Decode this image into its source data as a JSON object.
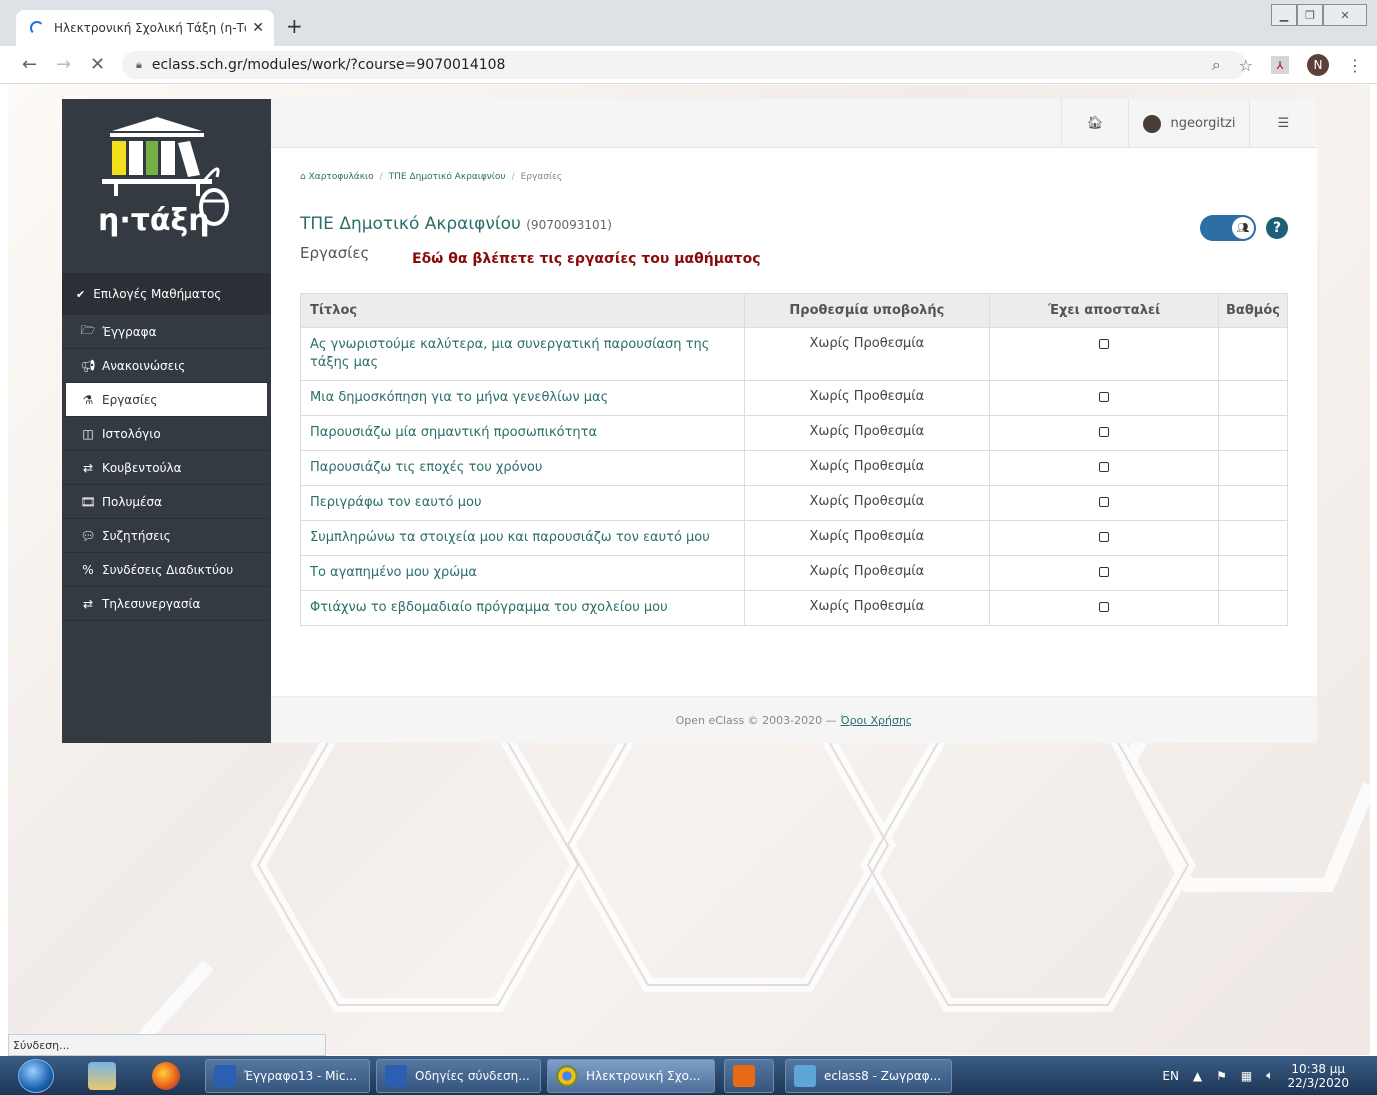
{
  "browser": {
    "tab_title": "Ηλεκτρονική Σχολική Τάξη (η-Τά",
    "tab_close": "✕",
    "new_tab": "+",
    "url": "eclass.sch.gr/modules/work/?course=9070014108",
    "profile_initial": "N",
    "status_text": "Σύνδεση..."
  },
  "sidebar": {
    "logo_text": "η·τάξη",
    "header": "Επιλογές Μαθήματος",
    "items": [
      {
        "label": "Έγγραφα",
        "icon": "folder-icon"
      },
      {
        "label": "Ανακοινώσεις",
        "icon": "megaphone-icon"
      },
      {
        "label": "Εργασίες",
        "icon": "flask-icon"
      },
      {
        "label": "Ιστολόγιο",
        "icon": "blog-icon"
      },
      {
        "label": "Κουβεντούλα",
        "icon": "exchange-icon"
      },
      {
        "label": "Πολυμέσα",
        "icon": "film-icon"
      },
      {
        "label": "Συζητήσεις",
        "icon": "comments-icon"
      },
      {
        "label": "Συνδέσεις Διαδικτύου",
        "icon": "link-icon"
      },
      {
        "label": "Τηλεσυνεργασία",
        "icon": "exchange-icon"
      }
    ]
  },
  "topbar": {
    "username": "ngeorgitzi"
  },
  "breadcrumb": {
    "home": "Χαρτοφυλάκιο",
    "course": "ΤΠΕ Δημοτικό Ακραιφνίου",
    "current": "Εργασίες"
  },
  "course": {
    "title": "ΤΠΕ Δημοτικό Ακραιφνίου",
    "code": "(9070093101)",
    "section": "Εργασίες",
    "annotation": "Εδώ θα βλέπετε τις εργασίες του μαθήματος"
  },
  "table": {
    "headers": [
      "Τίτλος",
      "Προθεσμία υποβολής",
      "Έχει αποσταλεί",
      "Βαθμός"
    ],
    "rows": [
      {
        "title": "Ας γνωριστούμε καλύτερα, μια συνεργατική παρουσίαση της τάξης μας",
        "deadline": "Χωρίς Προθεσμία",
        "grade": ""
      },
      {
        "title": "Μια δημοσκόπηση για το μήνα γενεθλίων μας",
        "deadline": "Χωρίς Προθεσμία",
        "grade": ""
      },
      {
        "title": "Παρουσιάζω μία σημαντική προσωπικότητα",
        "deadline": "Χωρίς Προθεσμία",
        "grade": ""
      },
      {
        "title": "Παρουσιάζω τις εποχές του χρόνου",
        "deadline": "Χωρίς Προθεσμία",
        "grade": ""
      },
      {
        "title": "Περιγράφω τον εαυτό μου",
        "deadline": "Χωρίς Προθεσμία",
        "grade": ""
      },
      {
        "title": "Συμπληρώνω τα στοιχεία μου και παρουσιάζω τον εαυτό μου",
        "deadline": "Χωρίς Προθεσμία",
        "grade": ""
      },
      {
        "title": "Το αγαπημένο μου χρώμα",
        "deadline": "Χωρίς Προθεσμία",
        "grade": ""
      },
      {
        "title": "Φτιάχνω το εβδομαδιαίο πρόγραμμα του σχολείου μου",
        "deadline": "Χωρίς Προθεσμία",
        "grade": ""
      }
    ]
  },
  "footer": {
    "copyright": "Open eClass © 2003-2020 —",
    "terms": "Όροι Χρήσης"
  },
  "taskbar": {
    "buttons": [
      {
        "label": "Έγγραφο13 - Mic...",
        "color": "#2b5fb4"
      },
      {
        "label": "Οδηγίες σύνδεση...",
        "color": "#2b5fb4"
      },
      {
        "label": "Ηλεκτρονική Σχο...",
        "color": "#e2a50f"
      },
      {
        "label": "",
        "color": "#e86a14"
      },
      {
        "label": "eclass8 - Ζωγραφ...",
        "color": "#5fa6d8"
      }
    ],
    "lang": "EN",
    "time": "10:38 μμ",
    "date": "22/3/2020"
  }
}
